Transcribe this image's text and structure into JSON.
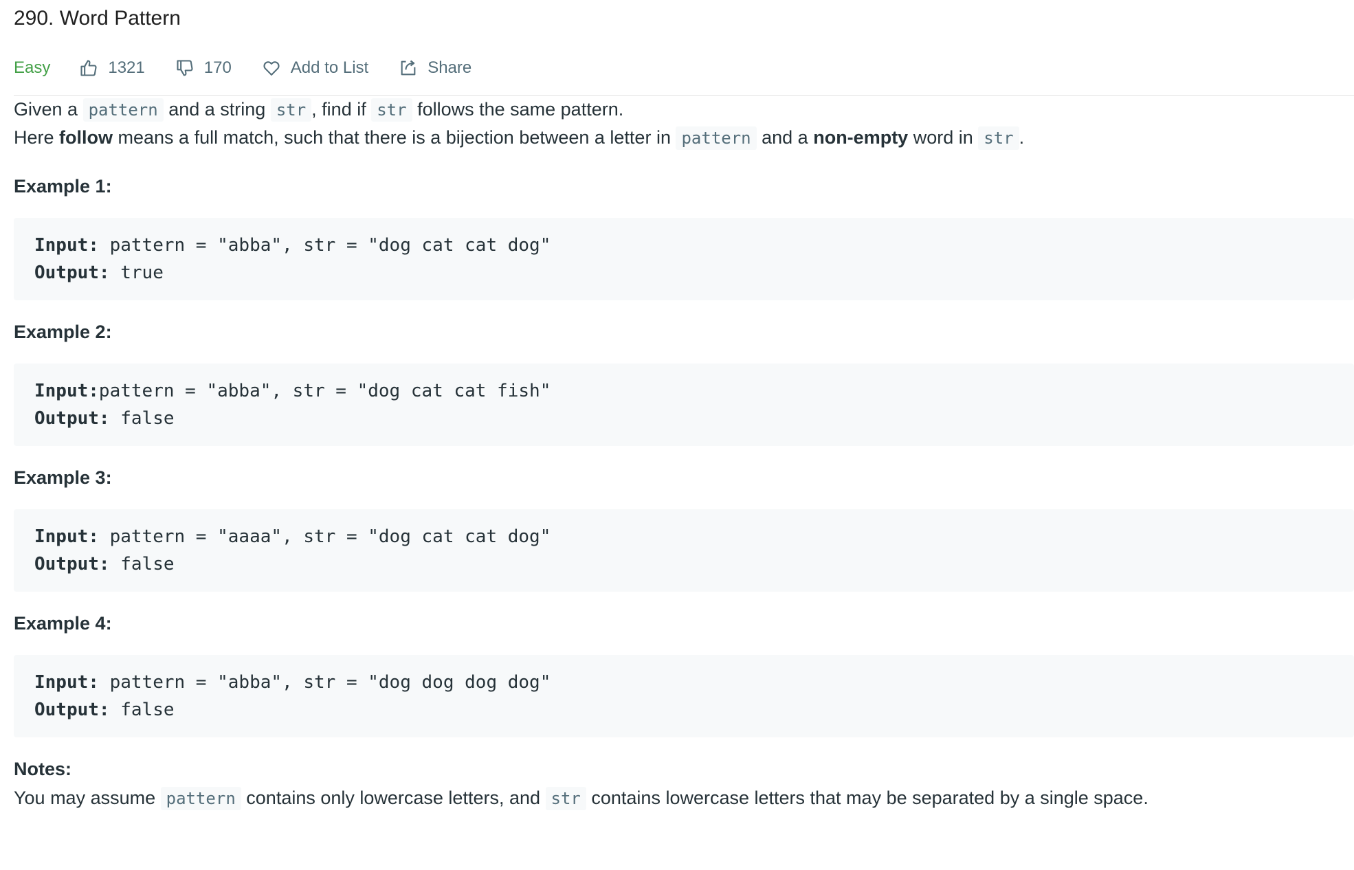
{
  "problem": {
    "title": "290. Word Pattern",
    "difficulty": "Easy",
    "likes": "1321",
    "dislikes": "170",
    "add_to_list_label": "Add to List",
    "share_label": "Share",
    "difficulty_color": "#43a047"
  },
  "description": {
    "para1": {
      "t1": "Given a ",
      "c1": "pattern",
      "t2": " and a string ",
      "c2": "str",
      "t3": ", find if ",
      "c3": "str",
      "t4": " follows the same pattern."
    },
    "para2": {
      "t1": "Here ",
      "b1": "follow",
      "t2": " means a full match, such that there is a bijection between a letter in ",
      "c1": "pattern",
      "t3": " and a ",
      "b2": "non-empty",
      "t4": " word in ",
      "c2": "str",
      "t5": "."
    }
  },
  "examples": [
    {
      "heading": "Example 1:",
      "input_label": "Input:",
      "input_value": " pattern = \"abba\", str = \"dog cat cat dog\"",
      "output_label": "Output:",
      "output_value": " true"
    },
    {
      "heading": "Example 2:",
      "input_label": "Input:",
      "input_value": "pattern = \"abba\", str = \"dog cat cat fish\"",
      "output_label": "Output:",
      "output_value": " false"
    },
    {
      "heading": "Example 3:",
      "input_label": "Input:",
      "input_value": " pattern = \"aaaa\", str = \"dog cat cat dog\"",
      "output_label": "Output:",
      "output_value": " false"
    },
    {
      "heading": "Example 4:",
      "input_label": "Input:",
      "input_value": " pattern = \"abba\", str = \"dog dog dog dog\"",
      "output_label": "Output:",
      "output_value": " false"
    }
  ],
  "notes": {
    "heading": "Notes:",
    "t1": "You may assume ",
    "c1": "pattern",
    "t2": " contains only lowercase letters, and ",
    "c2": "str",
    "t3": " contains lowercase letters that may be separated by a single space."
  },
  "icons": {
    "like": "thumbs-up-icon",
    "dislike": "thumbs-down-icon",
    "add_to_list": "heart-icon",
    "share": "share-icon"
  }
}
